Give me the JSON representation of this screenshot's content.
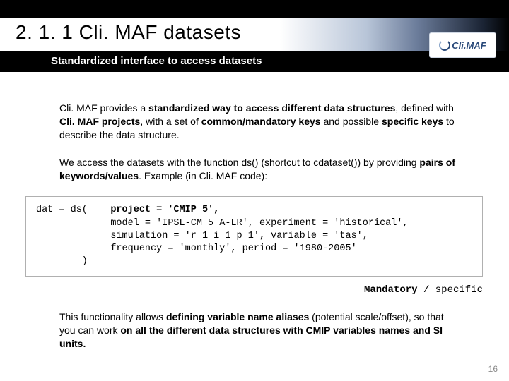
{
  "header": {
    "title": "2. 1. 1 Cli. MAF datasets",
    "subtitle": "Standardized interface to access datasets",
    "logo_text": "Cli.MAF"
  },
  "body": {
    "p1_pre": "Cli. MAF provides a ",
    "p1_b1": "standardized way to access different data structures",
    "p1_mid1": ", defined with ",
    "p1_b2": "Cli. MAF projects",
    "p1_mid2": ", with a set of ",
    "p1_b3": "common/mandatory keys",
    "p1_mid3": " and possible ",
    "p1_b4": "specific keys",
    "p1_post": " to describe the data structure.",
    "p2_pre": "We access the datasets with the function ds() (shortcut to cdataset()) by providing ",
    "p2_b1": "pairs of keywords/values",
    "p2_post": ". Example (in Cli. MAF code):",
    "code_l1a": "dat = ds(    ",
    "code_l1b": "project = 'CMIP 5',",
    "code_l2": "             model = 'IPSL-CM 5 A-LR', experiment = 'historical',",
    "code_l3": "             simulation = 'r 1 i 1 p 1', variable = 'tas',",
    "code_l4": "             frequency = 'monthly', period = '1980-2005'",
    "code_l5": "        )",
    "legend_mand": "Mandatory",
    "legend_sep": " / ",
    "legend_spec": "specific",
    "p3_pre": "This functionality allows ",
    "p3_b1": "defining variable name aliases",
    "p3_mid1": " (potential scale/offset), so that you can work ",
    "p3_b2": "on all the different data structures with CMIP variables names and SI units."
  },
  "page_number": "16"
}
